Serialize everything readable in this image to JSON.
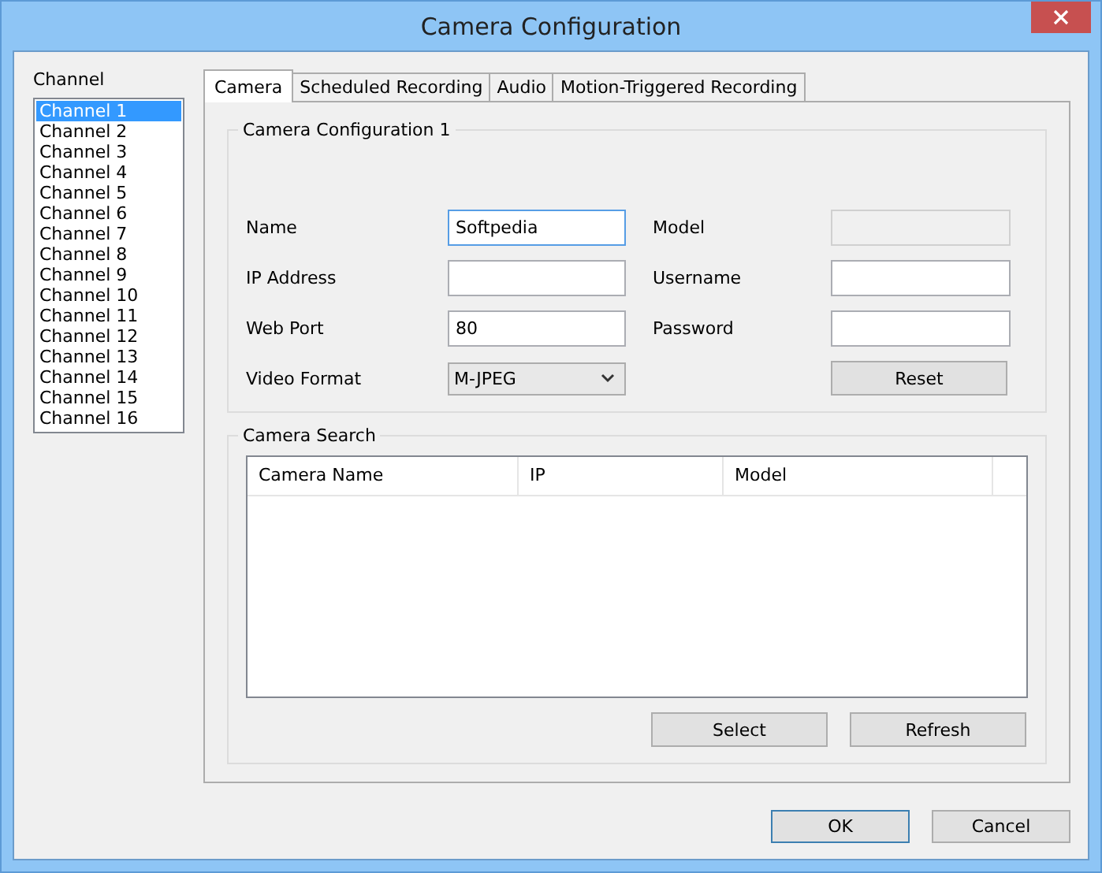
{
  "window": {
    "title": "Camera Configuration"
  },
  "channel": {
    "label": "Channel",
    "items": [
      {
        "label": "Channel 1",
        "selected": true
      },
      {
        "label": "Channel 2",
        "selected": false
      },
      {
        "label": "Channel 3",
        "selected": false
      },
      {
        "label": "Channel 4",
        "selected": false
      },
      {
        "label": "Channel 5",
        "selected": false
      },
      {
        "label": "Channel 6",
        "selected": false
      },
      {
        "label": "Channel 7",
        "selected": false
      },
      {
        "label": "Channel 8",
        "selected": false
      },
      {
        "label": "Channel 9",
        "selected": false
      },
      {
        "label": "Channel 10",
        "selected": false
      },
      {
        "label": "Channel 11",
        "selected": false
      },
      {
        "label": "Channel 12",
        "selected": false
      },
      {
        "label": "Channel 13",
        "selected": false
      },
      {
        "label": "Channel 14",
        "selected": false
      },
      {
        "label": "Channel 15",
        "selected": false
      },
      {
        "label": "Channel 16",
        "selected": false
      }
    ]
  },
  "tabs": [
    {
      "label": "Camera",
      "selected": true
    },
    {
      "label": "Scheduled Recording",
      "selected": false
    },
    {
      "label": "Audio",
      "selected": false
    },
    {
      "label": "Motion-Triggered Recording",
      "selected": false
    }
  ],
  "camera_config": {
    "title": "Camera Configuration 1",
    "fields": [
      {
        "kind": "text",
        "label": "Name",
        "value": "Softpedia",
        "focused": true,
        "disabled": false
      },
      {
        "kind": "text",
        "label": "Model",
        "focused": false,
        "disabled": true
      },
      {
        "kind": "text",
        "label": "IP Address",
        "focused": false,
        "disabled": false
      },
      {
        "kind": "text",
        "label": "Username",
        "focused": false,
        "disabled": false
      },
      {
        "kind": "text",
        "label": "Web Port",
        "value": "80",
        "focused": false,
        "disabled": false
      },
      {
        "kind": "text",
        "label": "Password",
        "focused": false,
        "disabled": false
      },
      {
        "kind": "dropdown",
        "label": "Video Format",
        "value": "M-JPEG"
      },
      {
        "kind": "button",
        "value": "Reset"
      }
    ]
  },
  "camera_search": {
    "title": "Camera Search",
    "columns": [
      "Camera Name",
      "IP",
      "Model"
    ],
    "buttons": [
      "Select",
      "Refresh"
    ]
  },
  "buttons": [
    {
      "label": "OK",
      "default": true
    },
    {
      "label": "Cancel",
      "default": false
    }
  ]
}
